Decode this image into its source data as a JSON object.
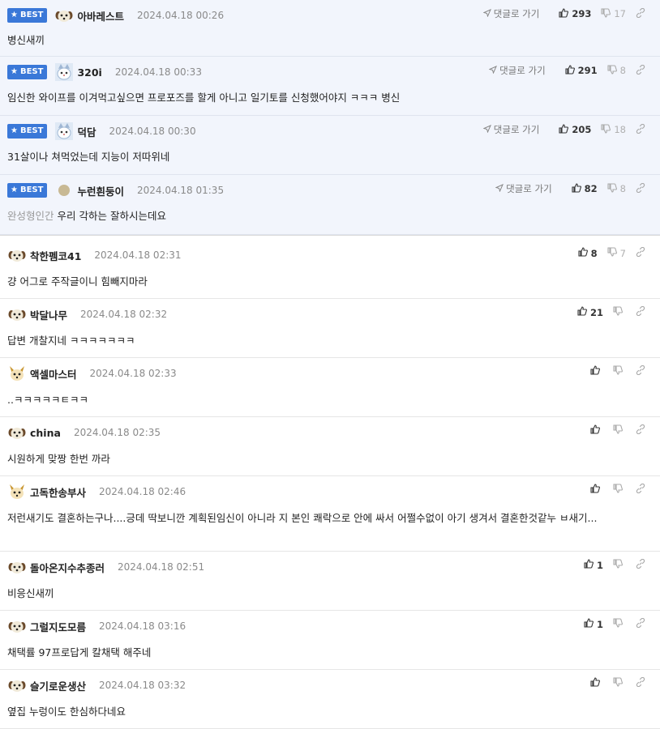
{
  "reply_label": "댓글로 가기",
  "best_label": "BEST",
  "comments": [
    {
      "best": true,
      "avatar": "dog",
      "nick": "아바레스트",
      "date": "2024.04.18 00:26",
      "text": "병신새끼",
      "up": "293",
      "down": "17"
    },
    {
      "best": true,
      "avatar": "cat",
      "nick": "320i",
      "date": "2024.04.18 00:33",
      "text": "임신한 와이프를 이겨먹고싶으면 프로포즈를 할게 아니고 일기토를 신청했어야지 ㅋㅋㅋ 병신",
      "up": "291",
      "down": "8"
    },
    {
      "best": true,
      "avatar": "cat",
      "nick": "덕담",
      "date": "2024.04.18 00:30",
      "text": "31살이나 쳐먹었는데 지능이 저따위네",
      "up": "205",
      "down": "18"
    },
    {
      "best": true,
      "avatar": "dot",
      "nick": "누런흰둥이",
      "date": "2024.04.18 01:35",
      "prefix": "완성형인간",
      "text": "우리 각하는 잘하시는데요",
      "up": "82",
      "down": "8"
    },
    {
      "best": false,
      "avatar": "dog",
      "nick": "착한펨코41",
      "date": "2024.04.18 02:31",
      "text": "걍 어그로 주작글이니 힘빼지마라",
      "up": "8",
      "down": "7"
    },
    {
      "best": false,
      "avatar": "dog",
      "nick": "박달나무",
      "date": "2024.04.18 02:32",
      "text": "답변 개찰지네 ㅋㅋㅋㅋㅋㅋㅋ",
      "up": "21",
      "down": ""
    },
    {
      "best": false,
      "avatar": "fox",
      "nick": "액셀마스터",
      "date": "2024.04.18 02:33",
      "text": "..ㅋㅋㅋㅋㅋㅌㅋㅋ",
      "up": "",
      "down": ""
    },
    {
      "best": false,
      "avatar": "dog",
      "nick": "china",
      "date": "2024.04.18 02:35",
      "text": "시원하게 맞짱 한번 까라",
      "up": "",
      "down": ""
    },
    {
      "best": false,
      "avatar": "fox",
      "nick": "고독한송부사",
      "date": "2024.04.18 02:46",
      "text": "저런새기도 결혼하는구나....긍데 딱보니깐 계획된임신이 아니라 지 본인 쾌락으로 안에 싸서 어쩔수없이 아기 생겨서 결혼한것같누 ㅂ새기...",
      "up": "",
      "down": ""
    },
    {
      "best": false,
      "avatar": "dog",
      "nick": "돌아온지수추종러",
      "date": "2024.04.18 02:51",
      "text": "비응신새끼",
      "up": "1",
      "down": ""
    },
    {
      "best": false,
      "avatar": "dog",
      "nick": "그럴지도모름",
      "date": "2024.04.18 03:16",
      "text": "채택률 97프로답게 칼채택 해주네",
      "up": "1",
      "down": ""
    },
    {
      "best": false,
      "avatar": "dog",
      "nick": "슬기로운생산",
      "date": "2024.04.18 03:32",
      "text": "옆집 누렁이도 한심하다네요",
      "up": "",
      "down": ""
    }
  ]
}
